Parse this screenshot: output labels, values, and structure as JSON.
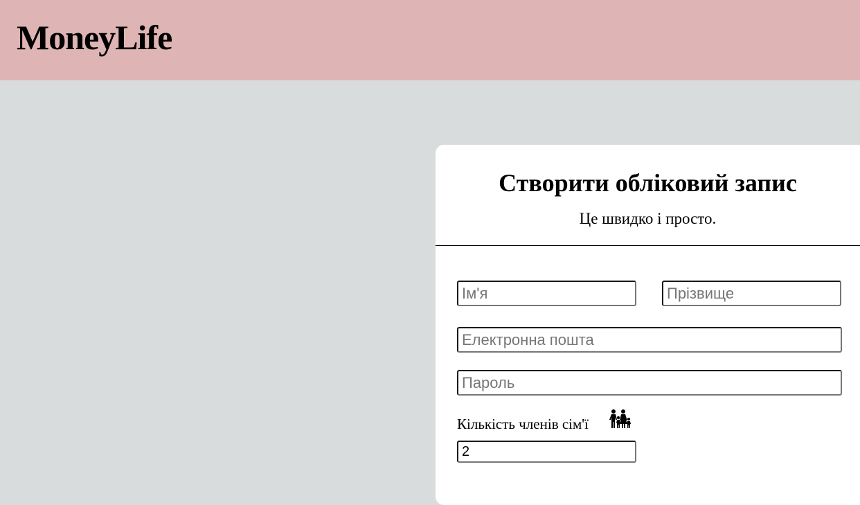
{
  "header": {
    "logo": "MoneyLife",
    "background_color": "#dfb4b4"
  },
  "signup": {
    "title": "Створити обліковий запис",
    "subtitle": "Це швидко і просто.",
    "first_name_placeholder": "Ім'я",
    "last_name_placeholder": "Прізвище",
    "email_placeholder": "Електронна пошта",
    "password_placeholder": "Пароль",
    "family_label": "Кількість членів сім'ї",
    "family_icon": "family-icon",
    "family_value": "2"
  },
  "page": {
    "background_color": "#d9dcdd"
  }
}
